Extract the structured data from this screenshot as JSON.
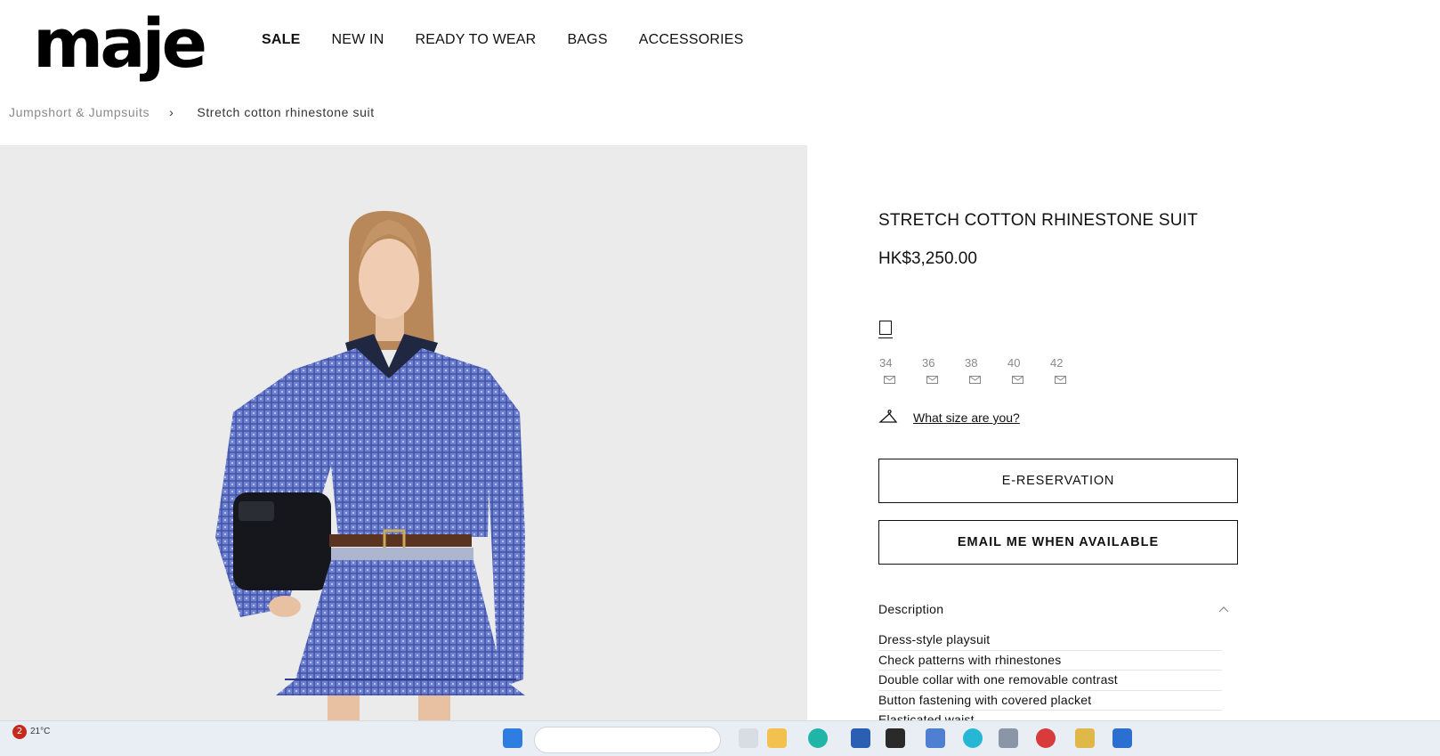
{
  "brand": {
    "logo_text": "maje"
  },
  "nav": {
    "items": [
      {
        "label": "SALE",
        "bold": true
      },
      {
        "label": "NEW IN",
        "bold": false
      },
      {
        "label": "READY TO WEAR",
        "bold": false
      },
      {
        "label": "BAGS",
        "bold": false
      },
      {
        "label": "ACCESSORIES",
        "bold": false
      }
    ]
  },
  "breadcrumb": {
    "parent": "Jumpshort & Jumpsuits",
    "separator": "›",
    "current": "Stretch cotton rhinestone suit"
  },
  "product": {
    "title": "STRETCH COTTON RHINESTONE SUIT",
    "price": "HK$3,250.00",
    "color_swatch_icon": "swatch-outline-icon",
    "sizes": [
      {
        "label": "34",
        "icon": "envelope-icon"
      },
      {
        "label": "36",
        "icon": "envelope-icon"
      },
      {
        "label": "38",
        "icon": "envelope-icon"
      },
      {
        "label": "40",
        "icon": "envelope-icon"
      },
      {
        "label": "42",
        "icon": "envelope-icon"
      }
    ],
    "size_guide_label": "What size are you?",
    "ereservation_label": "E-RESERVATION",
    "email_available_label": "EMAIL ME WHEN AVAILABLE",
    "description_heading": "Description",
    "description_items": [
      "Dress-style playsuit",
      "Check patterns with rhinestones",
      "Double collar with one removable contrast",
      "Button fastening with covered placket",
      "Elasticated waist"
    ]
  },
  "taskbar": {
    "notification_count": "2",
    "weather_text": "21°C"
  },
  "colors": {
    "image_background": "#ebebeb",
    "shirt_blue": "#5b6fc4",
    "text": "#111111",
    "muted": "#8a8a8a"
  }
}
